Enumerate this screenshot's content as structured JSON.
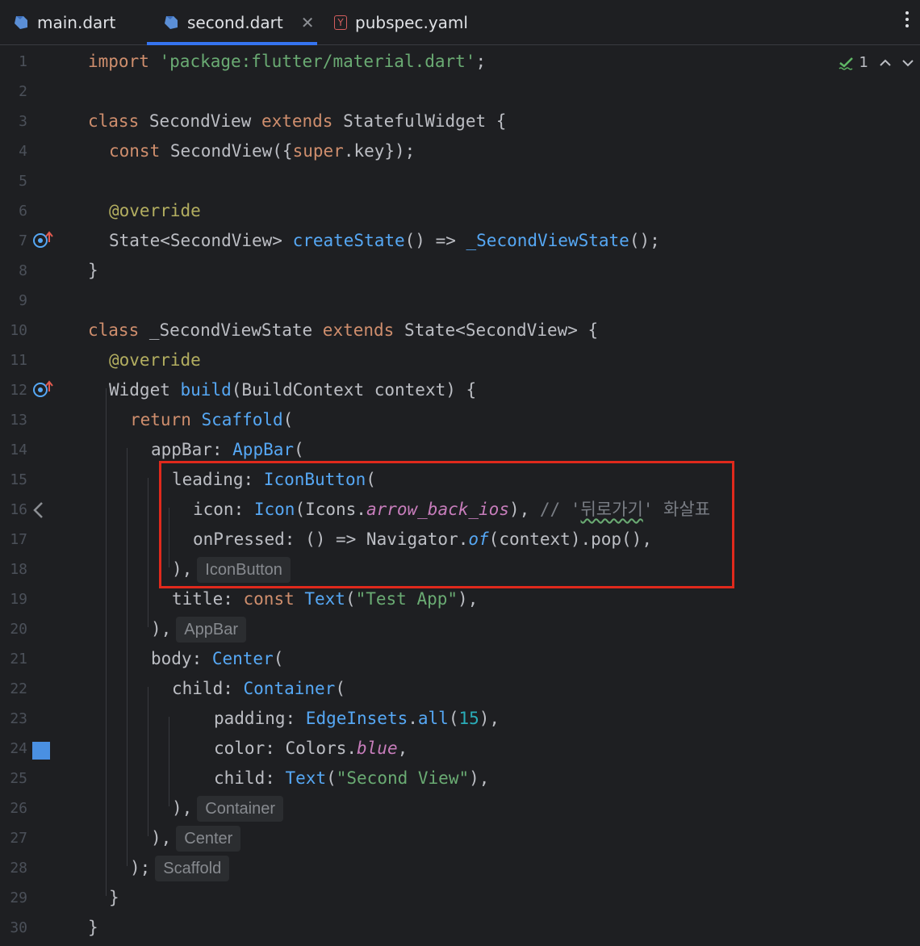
{
  "tabs": [
    {
      "label": "main.dart",
      "active": false
    },
    {
      "label": "second.dart",
      "active": true
    },
    {
      "label": "pubspec.yaml",
      "active": false
    }
  ],
  "inspection": {
    "count": "1"
  },
  "line_numbers": [
    "1",
    "2",
    "3",
    "4",
    "5",
    "6",
    "7",
    "8",
    "9",
    "10",
    "11",
    "12",
    "13",
    "14",
    "15",
    "16",
    "17",
    "18",
    "19",
    "20",
    "21",
    "22",
    "23",
    "24",
    "25",
    "26",
    "27",
    "28",
    "29",
    "30"
  ],
  "code": {
    "l1_import": "import",
    "l1_str": "'package:flutter/material.dart'",
    "l1_semi": ";",
    "l3_class": "class",
    "l3_name": " SecondView ",
    "l3_extends": "extends",
    "l3_rest": " StatefulWidget {",
    "l4_const": "const",
    "l4_mid": " SecondView({",
    "l4_super": "super",
    "l4_rest": ".key});",
    "l6_ann": "@override",
    "l7_a": "State<SecondView> ",
    "l7_fn": "createState",
    "l7_b": "() => ",
    "l7_fn2": "_SecondViewState",
    "l7_c": "();",
    "l8": "}",
    "l10_class": "class",
    "l10_name": " _SecondViewState ",
    "l10_extends": "extends",
    "l10_rest": " State<SecondView> {",
    "l11_ann": "@override",
    "l12_a": "Widget ",
    "l12_fn": "build",
    "l12_b": "(BuildContext context) {",
    "l13_ret": "return",
    "l13_fn": " Scaffold",
    "l13_b": "(",
    "l14_a": "appBar: ",
    "l14_fn": "AppBar",
    "l14_b": "(",
    "l15_a": "leading: ",
    "l15_fn": "IconButton",
    "l15_b": "(",
    "l16_a": "icon: ",
    "l16_fn": "Icon",
    "l16_b": "(Icons.",
    "l16_it": "arrow_back_ios",
    "l16_c": "), ",
    "l16_cmt1": "// '",
    "l16_cmt2": "뒤로가기",
    "l16_cmt3": "' 화살표",
    "l17_a": "onPressed: () => Navigator.",
    "l17_it": "of",
    "l17_b": "(context).pop(),",
    "l18_a": "),",
    "l18_hint": "IconButton",
    "l19_a": "title: ",
    "l19_const": "const",
    "l19_fn": " Text",
    "l19_b": "(",
    "l19_str": "\"Test App\"",
    "l19_c": "),",
    "l20_a": "),",
    "l20_hint": "AppBar",
    "l21_a": "body: ",
    "l21_fn": "Center",
    "l21_b": "(",
    "l22_a": "child: ",
    "l22_fn": "Container",
    "l22_b": "(",
    "l23_a": "padding: ",
    "l23_fn": "EdgeInsets",
    "l23_b": ".",
    "l23_fn2": "all",
    "l23_c": "(",
    "l23_num": "15",
    "l23_d": "),",
    "l24_a": "color: Colors.",
    "l24_it": "blue",
    "l24_b": ",",
    "l25_a": "child: ",
    "l25_fn": "Text",
    "l25_b": "(",
    "l25_str": "\"Second View\"",
    "l25_c": "),",
    "l26_a": "),",
    "l26_hint": "Container",
    "l27_a": "),",
    "l27_hint": "Center",
    "l28_a": ");",
    "l28_hint": "Scaffold",
    "l29": "}",
    "l30": "}"
  },
  "colors": {
    "background": "#1e1f22",
    "keyword": "#cf8e6d",
    "string": "#6aab73",
    "function": "#56a8f5",
    "annotation": "#b3ae60",
    "highlight_border": "#e0291c",
    "color_swatch": "#4a90e2"
  },
  "icons": [
    "dart-file-icon",
    "yaml-file-icon",
    "close-icon",
    "more-vertical-icon",
    "check-icon",
    "chevron-up-icon",
    "chevron-down-icon",
    "override-method-icon",
    "collapse-arrow-icon",
    "color-swatch-icon"
  ]
}
